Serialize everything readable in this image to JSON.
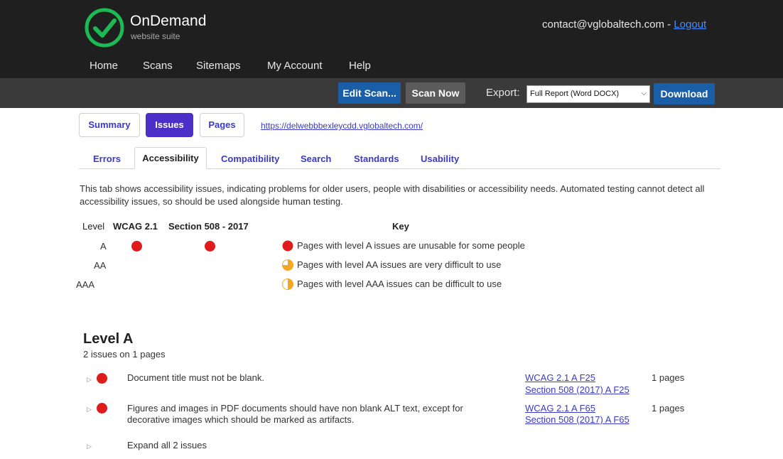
{
  "brand": {
    "name": "OnDemand",
    "subtitle": "website suite",
    "accent": "#1db954"
  },
  "account": {
    "email": "contact@vglobaltech.com",
    "separator": " - ",
    "logout_label": "Logout"
  },
  "nav": [
    "Home",
    "Scans",
    "Sitemaps",
    "My Account",
    "Help"
  ],
  "toolbar": {
    "edit_label": "Edit Scan...",
    "scan_label": "Scan Now",
    "export_label": "Export:",
    "export_selected": "Full Report (Word DOCX)",
    "download_label": "Download"
  },
  "main_tabs": [
    "Summary",
    "Issues",
    "Pages"
  ],
  "site_url": "https://delwebbbexleycdd.vglobaltech.com/",
  "sub_tabs": [
    "Errors",
    "Accessibility",
    "Compatibility",
    "Search",
    "Standards",
    "Usability"
  ],
  "description": "This tab shows accessibility issues, indicating problems for older users, people with disabilities or accessibility needs. Automated testing cannot detect all accessibility issues, so should be used alongside human testing.",
  "table": {
    "headers": {
      "level": "Level",
      "wcag": "WCAG 2.1",
      "s508": "Section 508 - 2017",
      "key": "Key"
    },
    "levels": [
      "A",
      "AA",
      "AAA"
    ]
  },
  "key": [
    {
      "icon": "full-red-circle",
      "text": "Pages with level A issues are unusable for some people"
    },
    {
      "icon": "three-quarter-orange-circle",
      "text": "Pages with level AA issues are very difficult to use"
    },
    {
      "icon": "half-orange-circle",
      "text": "Pages with level AAA issues can be difficult to use"
    }
  ],
  "section": {
    "title": "Level A",
    "count": "2 issues on 1 pages",
    "issues": [
      {
        "text": "Document title must not be blank.",
        "ref1": "WCAG 2.1 A F25",
        "ref2": "Section 508 (2017) A F25",
        "pages": "1 pages"
      },
      {
        "text": "Figures and images in PDF documents should have non blank ALT text, except for decorative images which should be marked as artifacts.",
        "ref1": "WCAG 2.1 A F65",
        "ref2": "Section 508 (2017) A F65",
        "pages": "1 pages"
      }
    ],
    "expand_label": "Expand all 2 issues"
  },
  "colors": {
    "header_bg": "#1f1f1f",
    "toolbar_bg": "#3a3a3a",
    "primary_blue": "#1b5ea8",
    "tab_active": "#4a30c9",
    "link": "#3a3ac4",
    "red": "#e01b1b",
    "orange": "#f5a623"
  }
}
